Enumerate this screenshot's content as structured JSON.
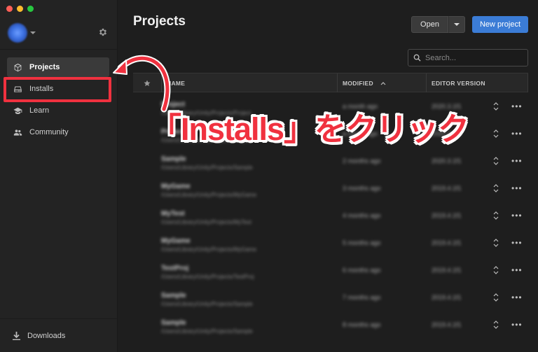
{
  "sidebar": {
    "settings_icon": "gear-icon",
    "nav": [
      {
        "label": "Projects",
        "icon": "cube-icon",
        "active": true
      },
      {
        "label": "Installs",
        "icon": "drive-icon",
        "active": false
      },
      {
        "label": "Learn",
        "icon": "graduation-cap-icon",
        "active": false
      },
      {
        "label": "Community",
        "icon": "people-icon",
        "active": false
      }
    ],
    "downloads": {
      "label": "Downloads",
      "icon": "download-icon"
    }
  },
  "main": {
    "title": "Projects",
    "open_label": "Open",
    "new_project_label": "New project",
    "search": {
      "placeholder": "Search..."
    },
    "table": {
      "columns": {
        "name": "NAME",
        "modified": "MODIFIED",
        "editor_version": "EDITOR VERSION"
      },
      "sort": {
        "column": "MODIFIED",
        "direction": "ascending"
      },
      "rows": [
        {
          "name": "Project",
          "path": "/Users/Library/Unity/Projects/Project",
          "modified": "a month ago",
          "version": "2020.3.1f1"
        },
        {
          "name": "Project",
          "path": "/Users/Library/Unity/Projects/Project",
          "modified": "a month ago",
          "version": "2020.3.1f1"
        },
        {
          "name": "Sample",
          "path": "/Users/Library/Unity/Projects/Sample",
          "modified": "2 months ago",
          "version": "2020.3.1f1"
        },
        {
          "name": "MyGame",
          "path": "/Users/Library/Unity/Projects/MyGame",
          "modified": "3 months ago",
          "version": "2019.4.1f1"
        },
        {
          "name": "MyTest",
          "path": "/Users/Library/Unity/Projects/MyTest",
          "modified": "4 months ago",
          "version": "2019.4.1f1"
        },
        {
          "name": "MyGame",
          "path": "/Users/Library/Unity/Projects/MyGame",
          "modified": "5 months ago",
          "version": "2019.4.1f1"
        },
        {
          "name": "TestProj",
          "path": "/Users/Library/Unity/Projects/TestProj",
          "modified": "6 months ago",
          "version": "2019.4.1f1"
        },
        {
          "name": "Sample",
          "path": "/Users/Library/Unity/Projects/Sample",
          "modified": "7 months ago",
          "version": "2019.4.1f1"
        },
        {
          "name": "Sample",
          "path": "/Users/Library/Unity/Projects/Sample",
          "modified": "8 months ago",
          "version": "2019.4.1f1"
        }
      ]
    }
  },
  "annotation": {
    "callout_text": "「Installs」をクリック",
    "color": "#f0313f"
  },
  "colors": {
    "accent": "#3b7cd6",
    "sidebar_bg": "#232323",
    "main_bg": "#1e1e1e"
  }
}
